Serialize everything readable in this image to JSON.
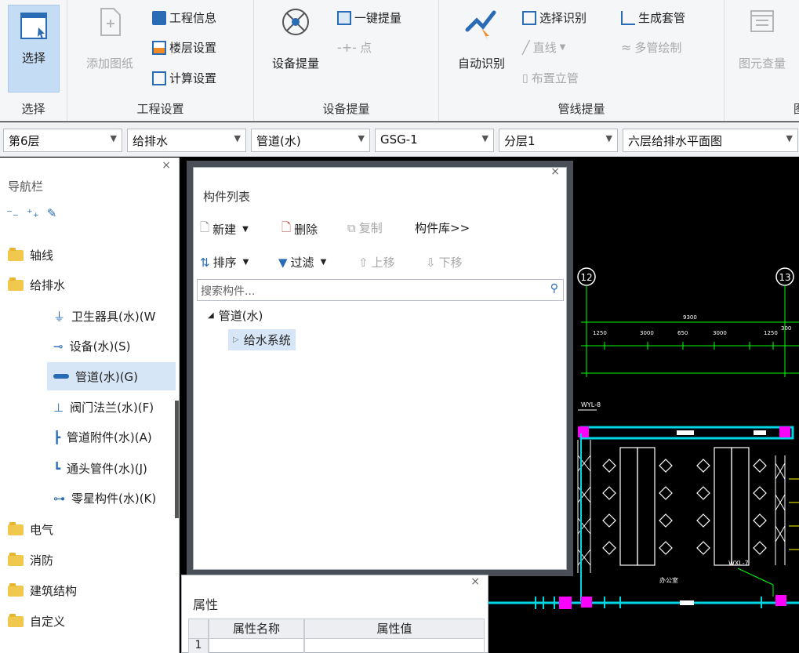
{
  "ribbon": {
    "groups": [
      {
        "title": "选择"
      },
      {
        "title": "工程设置"
      },
      {
        "title": "设备提量"
      },
      {
        "title": "管线提量"
      },
      {
        "title": "图"
      }
    ],
    "select": "选择",
    "add_drawing": "添加图纸",
    "project_info": "工程信息",
    "floor_settings": "楼层设置",
    "calc_settings": "计算设置",
    "device_extract": "设备提量",
    "one_key_extract": "一键提量",
    "point": "点",
    "auto_identify": "自动识别",
    "select_identify": "选择识别",
    "line": "直线",
    "place_riser": "布置立管",
    "gen_sleeve": "生成套管",
    "multi_pipe": "多管绘制",
    "element_qty": "图元查量"
  },
  "toolbar": {
    "floor": "第6层",
    "discipline": "给排水",
    "category": "管道(水)",
    "code": "GSG-1",
    "layer": "分层1",
    "drawing": "六层给排水平面图"
  },
  "nav": {
    "title": "导航栏",
    "items": [
      {
        "label": "轴线"
      },
      {
        "label": "给排水"
      },
      {
        "label": "卫生器具(水)(W"
      },
      {
        "label": "设备(水)(S)"
      },
      {
        "label": "管道(水)(G)"
      },
      {
        "label": "阀门法兰(水)(F)"
      },
      {
        "label": "管道附件(水)(A)"
      },
      {
        "label": "通头管件(水)(J)"
      },
      {
        "label": "零星构件(水)(K)"
      },
      {
        "label": "电气"
      },
      {
        "label": "消防"
      },
      {
        "label": "建筑结构"
      },
      {
        "label": "自定义"
      }
    ]
  },
  "component_list": {
    "title": "构件列表",
    "new": "新建",
    "delete": "删除",
    "copy": "复制",
    "library": "构件库>>",
    "sort": "排序",
    "filter": "过滤",
    "move_up": "上移",
    "move_down": "下移",
    "search_placeholder": "搜索构件...",
    "tree_root": "管道(水)",
    "tree_child": "给水系统"
  },
  "properties": {
    "title": "属性",
    "col_name": "属性名称",
    "col_value": "属性值",
    "row1": "1"
  },
  "cad": {
    "axis_12": "12",
    "axis_13": "13",
    "dim_total": "9300",
    "dims": [
      "1250",
      "3000",
      "650",
      "3000",
      "1250",
      "300"
    ],
    "tag1": "WYL-8",
    "tag2": "WXL-7",
    "room": "办公室"
  },
  "colors": {
    "accent": "#2a6bb6",
    "selection": "#d7e6f7",
    "cad_cyan": "#00d7e6",
    "cad_magenta": "#ff00ff",
    "cad_green": "#00ff00"
  }
}
